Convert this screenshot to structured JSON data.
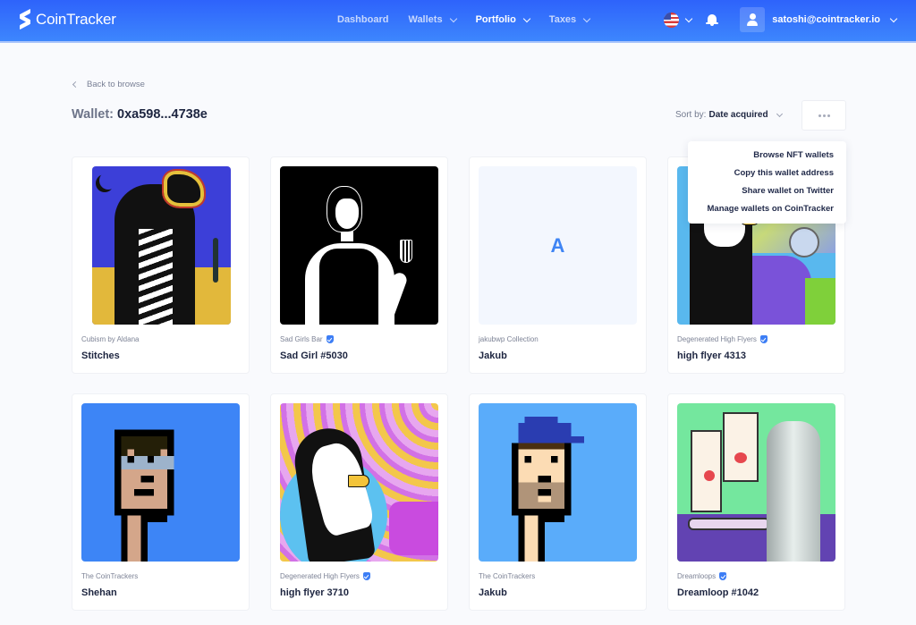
{
  "header": {
    "brand": "CoinTracker",
    "nav": [
      {
        "label": "Dashboard",
        "has_dropdown": false,
        "active": false
      },
      {
        "label": "Wallets",
        "has_dropdown": true,
        "active": false
      },
      {
        "label": "Portfolio",
        "has_dropdown": true,
        "active": true
      },
      {
        "label": "Taxes",
        "has_dropdown": true,
        "active": false
      }
    ],
    "language_icon": "us-flag-icon",
    "notifications_icon": "bell-icon",
    "user_email": "satoshi@cointracker.io"
  },
  "page": {
    "back_label": "Back to browse",
    "wallet_label": "Wallet:",
    "wallet_address": "0xa598...4738e",
    "sort_label": "Sort by:",
    "sort_value": "Date acquired",
    "more_icon": "ellipsis-icon"
  },
  "menu": {
    "items": [
      "Browse NFT wallets",
      "Copy this wallet address",
      "Share wallet on Twitter",
      "Manage wallets on CoinTracker"
    ]
  },
  "colors": {
    "brand_blue": "#2e63fb",
    "verified_blue": "#3d7ef5",
    "text_dark": "#1d2540"
  },
  "nfts": [
    {
      "collection": "Cubism by Aldana",
      "verified": false,
      "name": "Stitches"
    },
    {
      "collection": "Sad Girls Bar",
      "verified": true,
      "name": "Sad Girl #5030"
    },
    {
      "collection": "jakubwp Collection",
      "verified": false,
      "name": "Jakub",
      "placeholder_letter": "A"
    },
    {
      "collection": "Degenerated High Flyers",
      "verified": true,
      "name": "high flyer 4313"
    },
    {
      "collection": "The CoinTrackers",
      "verified": false,
      "name": "Shehan"
    },
    {
      "collection": "Degenerated High Flyers",
      "verified": true,
      "name": "high flyer 3710"
    },
    {
      "collection": "The CoinTrackers",
      "verified": false,
      "name": "Jakub"
    },
    {
      "collection": "Dreamloops",
      "verified": true,
      "name": "Dreamloop #1042"
    }
  ]
}
